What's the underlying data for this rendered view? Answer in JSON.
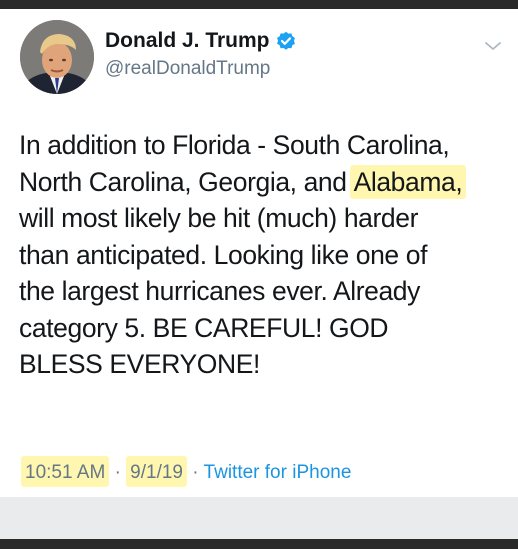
{
  "tweet": {
    "display_name": "Donald J. Trump",
    "handle": "@realDonaldTrump",
    "verified": true,
    "text_lines": [
      [
        "In addition to Florida - South Carolina,"
      ],
      [
        "North Carolina, Georgia, and ",
        "Alabama,"
      ],
      [
        "will most likely be hit (much) harder"
      ],
      [
        "than anticipated. Looking like one of"
      ],
      [
        "the largest hurricanes ever. Already"
      ],
      [
        "category 5. BE CAREFUL! GOD"
      ],
      [
        "BLESS EVERYONE!"
      ]
    ],
    "highlighted_word": "Alabama,",
    "time": "10:51 AM",
    "separator": "·",
    "date": "9/1/19",
    "source": "Twitter for iPhone"
  },
  "colors": {
    "name": "#14171a",
    "secondary": "#657786",
    "link": "#1b95e0",
    "verified": "#1da1f2",
    "highlight": "#fff06e"
  },
  "icons": {
    "verified": "verified-badge-icon",
    "menu": "chevron-down-icon"
  }
}
